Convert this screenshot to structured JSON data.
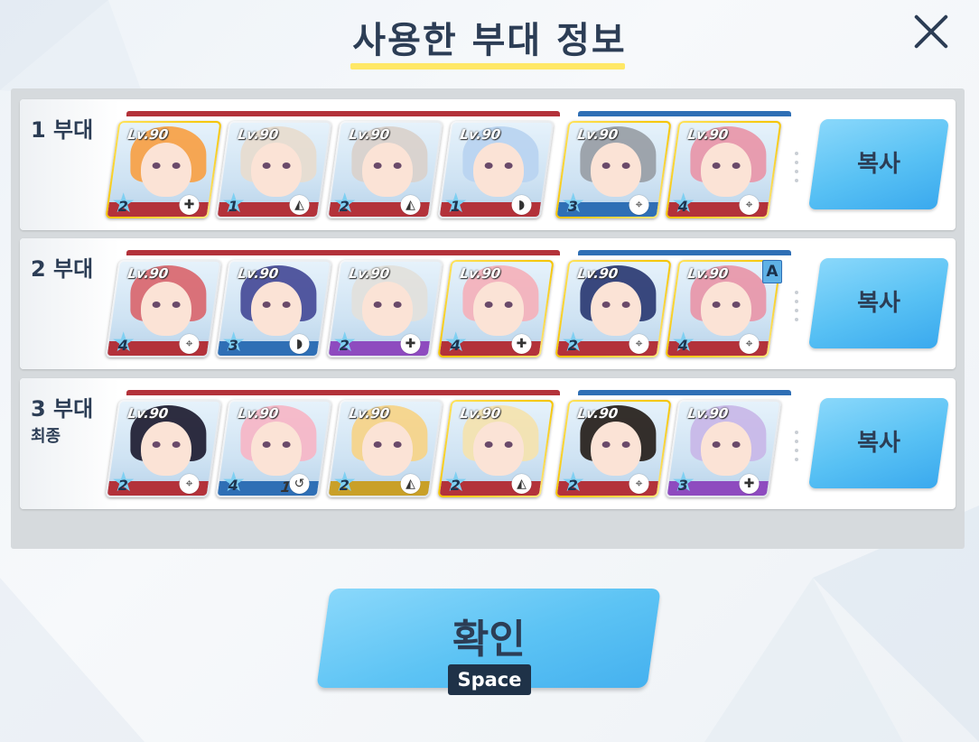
{
  "header": {
    "title": "사용한 부대 정보"
  },
  "colors": {
    "accent_button": "#58c1f4",
    "title_text": "#2c3d55",
    "title_underline": "#ffe866",
    "striker_bar": "#b3323a",
    "special_bar": "#2f6fb5"
  },
  "squads": [
    {
      "label": "1 부대",
      "sublabel": "",
      "copy_label": "복사",
      "cards": [
        {
          "level": "Lv.90",
          "stars": "2",
          "role": "heal-icon",
          "hair": "#f7a24a",
          "band": "#b3323a",
          "frame": "gold"
        },
        {
          "level": "Lv.90",
          "stars": "1",
          "role": "support-icon",
          "hair": "#e7dcd0",
          "band": "#b3323a",
          "frame": "white"
        },
        {
          "level": "Lv.90",
          "stars": "2",
          "role": "support-icon",
          "hair": "#d9d2cc",
          "band": "#b3323a",
          "frame": "white"
        },
        {
          "level": "Lv.90",
          "stars": "1",
          "role": "tank-icon",
          "hair": "#b9d4f0",
          "band": "#b3323a",
          "frame": "white"
        },
        {
          "level": "Lv.90",
          "stars": "3",
          "role": "dealer-icon",
          "hair": "#9aa0a8",
          "band": "#2f6fb5",
          "frame": "gold"
        },
        {
          "level": "Lv.90",
          "stars": "4",
          "role": "dealer-icon",
          "hair": "#e898ab",
          "band": "#b3323a",
          "frame": "gold"
        }
      ]
    },
    {
      "label": "2 부대",
      "sublabel": "",
      "copy_label": "복사",
      "badge": "A",
      "cards": [
        {
          "level": "Lv.90",
          "stars": "4",
          "role": "dealer-icon",
          "hair": "#d96a72",
          "band": "#b3323a",
          "frame": "white"
        },
        {
          "level": "Lv.90",
          "stars": "3",
          "role": "tank-icon",
          "hair": "#4a4f9a",
          "band": "#2f6fb5",
          "frame": "white"
        },
        {
          "level": "Lv.90",
          "stars": "2",
          "role": "heal-icon",
          "hair": "#e2e0dc",
          "band": "#8e4bbf",
          "frame": "white"
        },
        {
          "level": "Lv.90",
          "stars": "4",
          "role": "heal-icon",
          "hair": "#f3b2bc",
          "band": "#b3323a",
          "frame": "gold"
        },
        {
          "level": "Lv.90",
          "stars": "2",
          "role": "dealer-icon",
          "hair": "#2f3e76",
          "band": "#b3323a",
          "frame": "gold"
        },
        {
          "level": "Lv.90",
          "stars": "4",
          "role": "dealer-icon",
          "hair": "#e898ab",
          "band": "#b3323a",
          "frame": "gold"
        }
      ]
    },
    {
      "label": "3 부대",
      "sublabel": "최종",
      "copy_label": "복사",
      "cards": [
        {
          "level": "Lv.90",
          "stars": "2",
          "role": "dealer-icon",
          "hair": "#232236",
          "band": "#b3323a",
          "frame": "white"
        },
        {
          "level": "Lv.90",
          "stars": "4",
          "role": "bond-icon",
          "bond": "1",
          "hair": "#f5b7c7",
          "band": "#2f6fb5",
          "frame": "white"
        },
        {
          "level": "Lv.90",
          "stars": "2",
          "role": "support-icon",
          "hair": "#f6d48a",
          "band": "#c9a028",
          "frame": "white"
        },
        {
          "level": "Lv.90",
          "stars": "2",
          "role": "support-icon",
          "hair": "#f3e3b0",
          "band": "#b3323a",
          "frame": "gold"
        },
        {
          "level": "Lv.90",
          "stars": "2",
          "role": "dealer-icon",
          "hair": "#2a2420",
          "band": "#b3323a",
          "frame": "gold"
        },
        {
          "level": "Lv.90",
          "stars": "3",
          "role": "heal-icon",
          "hair": "#c8b8e8",
          "band": "#8e4bbf",
          "frame": "white"
        }
      ]
    }
  ],
  "footer": {
    "confirm_label": "확인",
    "key_hint": "Space"
  }
}
